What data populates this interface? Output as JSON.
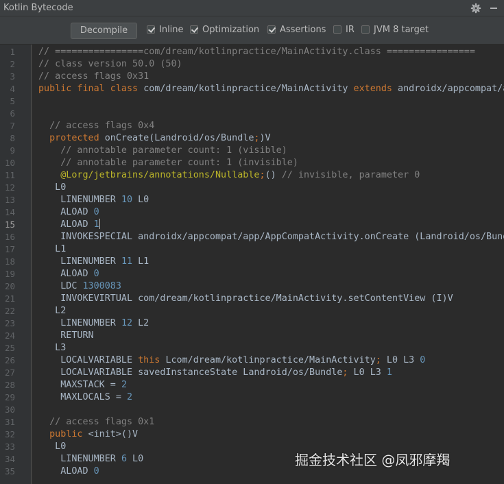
{
  "window": {
    "title": "Kotlin Bytecode"
  },
  "icons": {
    "settings": "gear-icon",
    "minimize": "minimize-icon"
  },
  "toolbar": {
    "decompile_label": "Decompile",
    "options": [
      {
        "label": "Inline",
        "checked": true
      },
      {
        "label": "Optimization",
        "checked": true
      },
      {
        "label": "Assertions",
        "checked": true
      },
      {
        "label": "IR",
        "checked": false
      },
      {
        "label": "JVM 8 target",
        "checked": false
      }
    ]
  },
  "editor": {
    "current_line": 15,
    "line_numbers": [
      "1",
      "2",
      "3",
      "4",
      "5",
      "6",
      "7",
      "8",
      "9",
      "10",
      "11",
      "12",
      "13",
      "14",
      "15",
      "16",
      "17",
      "18",
      "19",
      "20",
      "21",
      "22",
      "23",
      "24",
      "25",
      "26",
      "27",
      "28",
      "29",
      "30",
      "31",
      "32",
      "33",
      "34",
      "35"
    ],
    "lines": [
      [
        [
          "c",
          "// ================com/dream/kotlinpractice/MainActivity.class ================"
        ]
      ],
      [
        [
          "c",
          "// class version 50.0 (50)"
        ]
      ],
      [
        [
          "c",
          "// access flags 0x31"
        ]
      ],
      [
        [
          "k",
          "public final class "
        ],
        [
          "t",
          "com/dream/kotlinpractice/MainActivity "
        ],
        [
          "k",
          "extends "
        ],
        [
          "t",
          "androidx/appcompat/app/AppCompatActivity"
        ]
      ],
      [],
      [],
      [
        [
          "t",
          "  "
        ],
        [
          "c",
          "// access flags 0x4"
        ]
      ],
      [
        [
          "t",
          "  "
        ],
        [
          "k",
          "protected "
        ],
        [
          "t",
          "onCreate(Landroid/os/Bundle"
        ],
        [
          "k",
          ";"
        ],
        [
          "t",
          ")V"
        ]
      ],
      [
        [
          "t",
          "    "
        ],
        [
          "c",
          "// annotable parameter count: 1 (visible)"
        ]
      ],
      [
        [
          "t",
          "    "
        ],
        [
          "c",
          "// annotable parameter count: 1 (invisible)"
        ]
      ],
      [
        [
          "t",
          "    "
        ],
        [
          "a",
          "@Lorg/jetbrains/annotations/Nullable"
        ],
        [
          "k",
          ";"
        ],
        [
          "t",
          "() "
        ],
        [
          "c",
          "// invisible, parameter 0"
        ]
      ],
      [
        [
          "t",
          "   L0"
        ]
      ],
      [
        [
          "t",
          "    LINENUMBER "
        ],
        [
          "n",
          "10"
        ],
        [
          "t",
          " L0"
        ]
      ],
      [
        [
          "t",
          "    ALOAD "
        ],
        [
          "n",
          "0"
        ]
      ],
      [
        [
          "t",
          "    ALOAD "
        ],
        [
          "n",
          "1"
        ],
        [
          "caret",
          ""
        ]
      ],
      [
        [
          "t",
          "    INVOKESPECIAL androidx/appcompat/app/AppCompatActivity.onCreate (Landroid/os/Bundle;)V"
        ]
      ],
      [
        [
          "t",
          "   L1"
        ]
      ],
      [
        [
          "t",
          "    LINENUMBER "
        ],
        [
          "n",
          "11"
        ],
        [
          "t",
          " L1"
        ]
      ],
      [
        [
          "t",
          "    ALOAD "
        ],
        [
          "n",
          "0"
        ]
      ],
      [
        [
          "t",
          "    LDC "
        ],
        [
          "n",
          "1300083"
        ]
      ],
      [
        [
          "t",
          "    INVOKEVIRTUAL com/dream/kotlinpractice/MainActivity.setContentView (I)V"
        ]
      ],
      [
        [
          "t",
          "   L2"
        ]
      ],
      [
        [
          "t",
          "    LINENUMBER "
        ],
        [
          "n",
          "12"
        ],
        [
          "t",
          " L2"
        ]
      ],
      [
        [
          "t",
          "    RETURN"
        ]
      ],
      [
        [
          "t",
          "   L3"
        ]
      ],
      [
        [
          "t",
          "    LOCALVARIABLE "
        ],
        [
          "k",
          "this "
        ],
        [
          "t",
          "Lcom/dream/kotlinpractice/MainActivity"
        ],
        [
          "k",
          ";"
        ],
        [
          "t",
          " L0 L3 "
        ],
        [
          "n",
          "0"
        ]
      ],
      [
        [
          "t",
          "    LOCALVARIABLE savedInstanceState Landroid/os/Bundle"
        ],
        [
          "k",
          ";"
        ],
        [
          "t",
          " L0 L3 "
        ],
        [
          "n",
          "1"
        ]
      ],
      [
        [
          "t",
          "    MAXSTACK = "
        ],
        [
          "n",
          "2"
        ]
      ],
      [
        [
          "t",
          "    MAXLOCALS = "
        ],
        [
          "n",
          "2"
        ]
      ],
      [],
      [
        [
          "t",
          "  "
        ],
        [
          "c",
          "// access flags 0x1"
        ]
      ],
      [
        [
          "t",
          "  "
        ],
        [
          "k",
          "public "
        ],
        [
          "t",
          "<init>()V"
        ]
      ],
      [
        [
          "t",
          "   L0"
        ]
      ],
      [
        [
          "t",
          "    LINENUMBER "
        ],
        [
          "n",
          "6"
        ],
        [
          "t",
          " L0"
        ]
      ],
      [
        [
          "t",
          "    ALOAD "
        ],
        [
          "n",
          "0"
        ]
      ]
    ]
  },
  "watermark": {
    "text": "掘金技术社区 @凤邪摩羯"
  }
}
